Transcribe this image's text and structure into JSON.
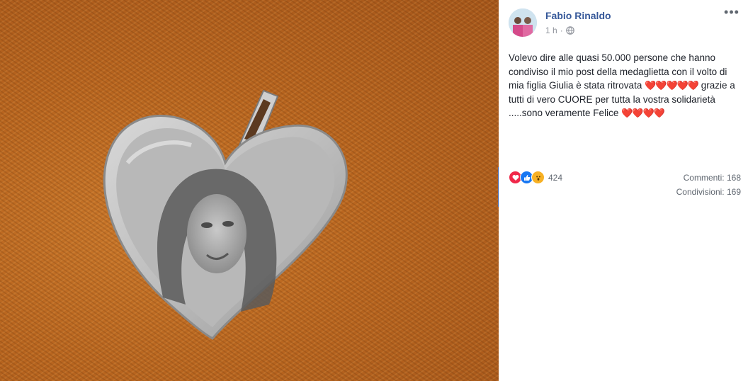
{
  "photo": {
    "subject": "heart-shaped-medal-photo"
  },
  "post": {
    "author": "Fabio Rinaldo",
    "time": "1 h",
    "visibility_icon": "globe-icon",
    "more_icon": "more-options-icon",
    "more_label": "•••",
    "text_line1": "Volevo dire alle quasi 50.000 persone che hanno condiviso il mio post della medaglietta con il volto di mia figlia Giulia è stata ritrovata ",
    "hearts_1": "❤️❤️❤️❤️❤️",
    "text_line2": " grazie a tutti di vero CUORE per tutta la vostra solidarietà .....sono veramente Felice ",
    "hearts_2": "❤️❤️❤️❤️"
  },
  "stats": {
    "reaction_icons": [
      "love-reaction-icon",
      "like-reaction-icon",
      "wow-reaction-icon"
    ],
    "reactions_count": "424",
    "comments": "Commenti: 168",
    "shares": "Condivisioni: 169"
  },
  "colors": {
    "name_link": "#365899",
    "accent": "#4267b2",
    "love": "#f0284a",
    "like": "#1877f2",
    "wow": "#f7b125"
  }
}
